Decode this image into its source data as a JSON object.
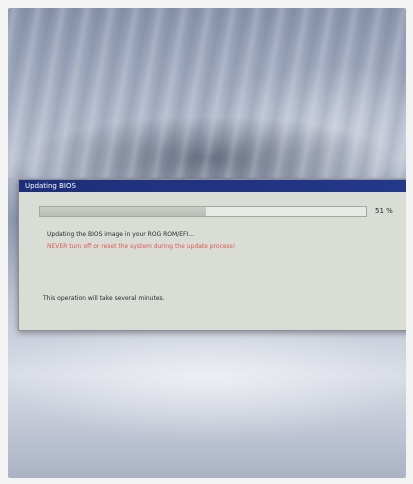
{
  "window": {
    "title": "Updating BIOS"
  },
  "progress": {
    "value": 0.51,
    "percent_label": "51 %"
  },
  "messages": {
    "status": "Updating the BIOS image in your ROG ROM/EFI...",
    "warning": "NEVER turn off or reset the system during the update process!",
    "footer": "This operation will take several minutes."
  }
}
